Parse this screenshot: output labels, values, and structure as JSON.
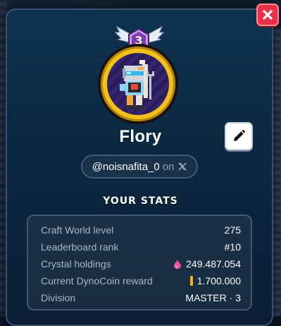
{
  "profile": {
    "level": "3",
    "username": "Flory",
    "handle": "@noisnafita_0",
    "handle_on": "on"
  },
  "stats": {
    "title": "YOUR STATS",
    "rows": [
      {
        "label": "Craft World level",
        "value": "275"
      },
      {
        "label": "Leaderboard rank",
        "value": "#10"
      },
      {
        "label": "Crystal holdings",
        "value": "249.487.054",
        "icon": "crystal-icon"
      },
      {
        "label": "Current DynoCoin reward",
        "value": "1.700.000",
        "icon": "dynocoin-icon"
      },
      {
        "label": "Division",
        "value": "MASTER · 3"
      }
    ]
  },
  "colors": {
    "close_button": "#e8324a",
    "panel": "#0b2740",
    "avatar_ring": "#f2c21a",
    "level_badge": "#7b3fb0"
  },
  "icons": {
    "close": "close-icon",
    "edit": "pencil-icon",
    "social": "x-logo-icon"
  }
}
